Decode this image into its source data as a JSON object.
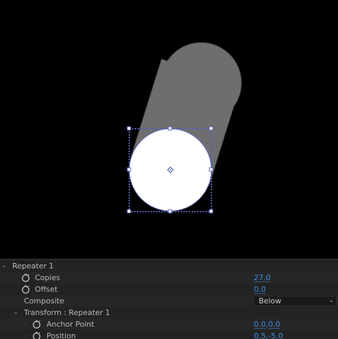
{
  "layers_panel": {
    "repeater": {
      "label": "Repeater 1",
      "copies": {
        "label": "Copies",
        "value": "27.0"
      },
      "offset": {
        "label": "Offset",
        "value": "0.0"
      },
      "composite": {
        "label": "Composite",
        "value": "Below"
      },
      "transform": {
        "label": "Transform : Repeater 1",
        "anchor_point": {
          "label": "Anchor Point",
          "value_x": "0.0",
          "value_y": "0.0"
        },
        "position": {
          "label": "Position",
          "value_x": "0.5",
          "value_y": "-5.0"
        }
      }
    }
  },
  "icons": {
    "twirl_open": "chevron-down-icon",
    "stopwatch": "stopwatch-icon",
    "dropdown": "chevron-down-icon"
  },
  "colors": {
    "viewport_bg": "#000000",
    "shape_fill": "#ffffff",
    "trail_fill": "#6e6e6e",
    "selection": "#5561b8",
    "value_blue": "#3d8ee6",
    "panel_bg": "#232323"
  }
}
